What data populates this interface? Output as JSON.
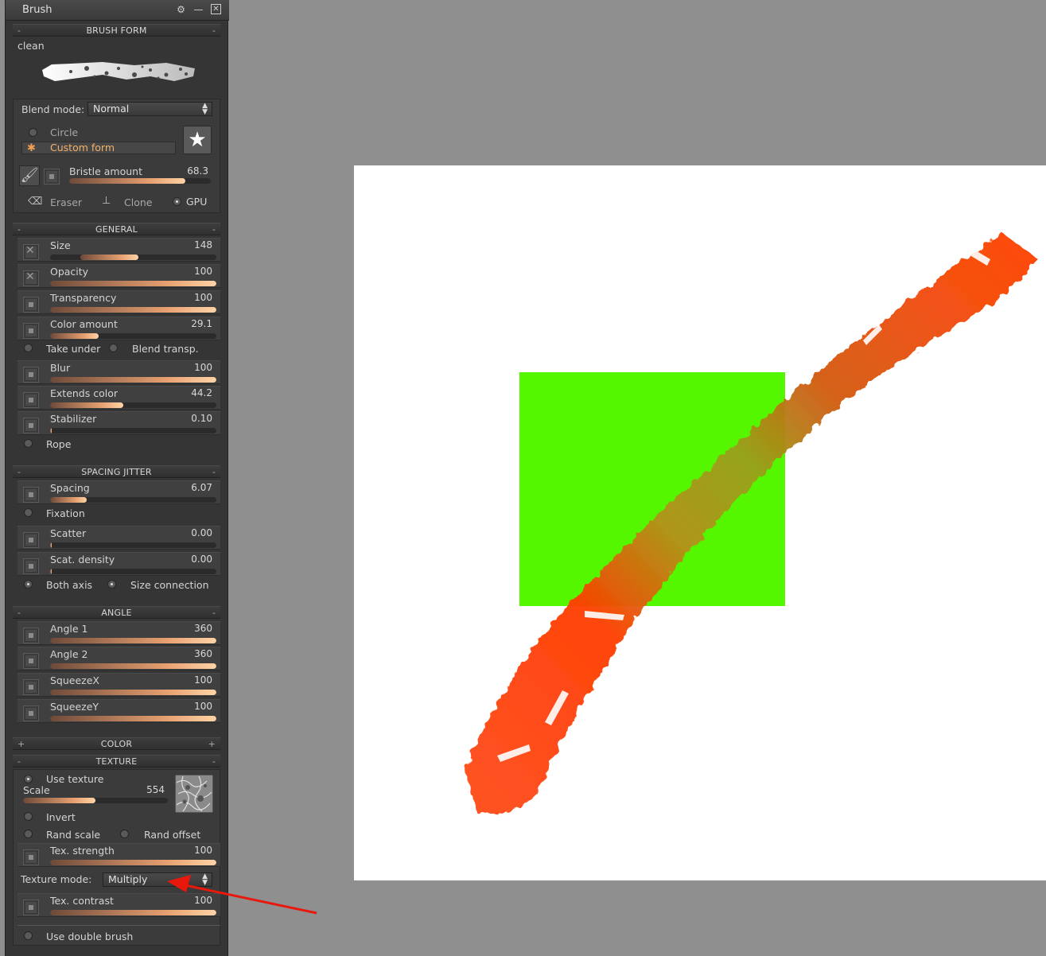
{
  "panel": {
    "title": "Brush",
    "icons": [
      "gear-icon",
      "minimize-icon",
      "close-icon"
    ]
  },
  "brush_form": {
    "header": "BRUSH FORM",
    "preset": "clean",
    "blend_label": "Blend mode:",
    "blend_value": "Normal",
    "shape_circle": "Circle",
    "shape_custom": "Custom form",
    "bristle_label": "Bristle amount",
    "bristle_value": "68.3",
    "bristle_fraction": 0.82,
    "eraser": "Eraser",
    "clone": "Clone",
    "gpu": "GPU"
  },
  "general": {
    "header": "GENERAL",
    "sliders": [
      {
        "label": "Size",
        "value": "148",
        "fraction": 0.35,
        "start": 0.18,
        "x": true
      },
      {
        "label": "Opacity",
        "value": "100",
        "fraction": 1.0,
        "x": true
      },
      {
        "label": "Transparency",
        "value": "100",
        "fraction": 1.0
      },
      {
        "label": "Color amount",
        "value": "29.1",
        "fraction": 0.29
      }
    ],
    "take_under": "Take under",
    "blend_transp": "Blend transp.",
    "sliders2": [
      {
        "label": "Blur",
        "value": "100",
        "fraction": 1.0
      },
      {
        "label": "Extends color",
        "value": "44.2",
        "fraction": 0.44
      },
      {
        "label": "Stabilizer",
        "value": "0.10",
        "fraction": 0.01
      }
    ],
    "rope": "Rope"
  },
  "spacing": {
    "header": "SPACING JITTER",
    "spacing_label": "Spacing",
    "spacing_value": "6.07",
    "spacing_fraction": 0.22,
    "fixation": "Fixation",
    "scatter_label": "Scatter",
    "scatter_value": "0.00",
    "scat_density_label": "Scat. density",
    "scat_density_value": "0.00",
    "both_axis": "Both axis",
    "size_connection": "Size connection"
  },
  "angle": {
    "header": "ANGLE",
    "sliders": [
      {
        "label": "Angle 1",
        "value": "360",
        "fraction": 1.0
      },
      {
        "label": "Angle 2",
        "value": "360",
        "fraction": 1.0
      },
      {
        "label": "SqueezeX",
        "value": "100",
        "fraction": 1.0
      },
      {
        "label": "SqueezeY",
        "value": "100",
        "fraction": 1.0
      }
    ]
  },
  "color": {
    "header": "COLOR"
  },
  "texture": {
    "header": "TEXTURE",
    "use_texture": "Use texture",
    "scale_label": "Scale",
    "scale_value": "554",
    "scale_fraction": 0.5,
    "invert": "Invert",
    "rand_scale": "Rand scale",
    "rand_offset": "Rand offset",
    "tex_strength_label": "Tex. strength",
    "tex_strength_value": "100",
    "mode_label": "Texture mode:",
    "mode_value": "Multiply",
    "tex_contrast_label": "Tex. contrast",
    "tex_contrast_value": "100",
    "double_brush": "Use double brush"
  },
  "colors": {
    "canvas_bg": "#ffffff",
    "workspace": "#8f8f8f",
    "green_rect": "#55f700",
    "stroke_red": "#ff3c00",
    "arrow": "#e8190c"
  }
}
